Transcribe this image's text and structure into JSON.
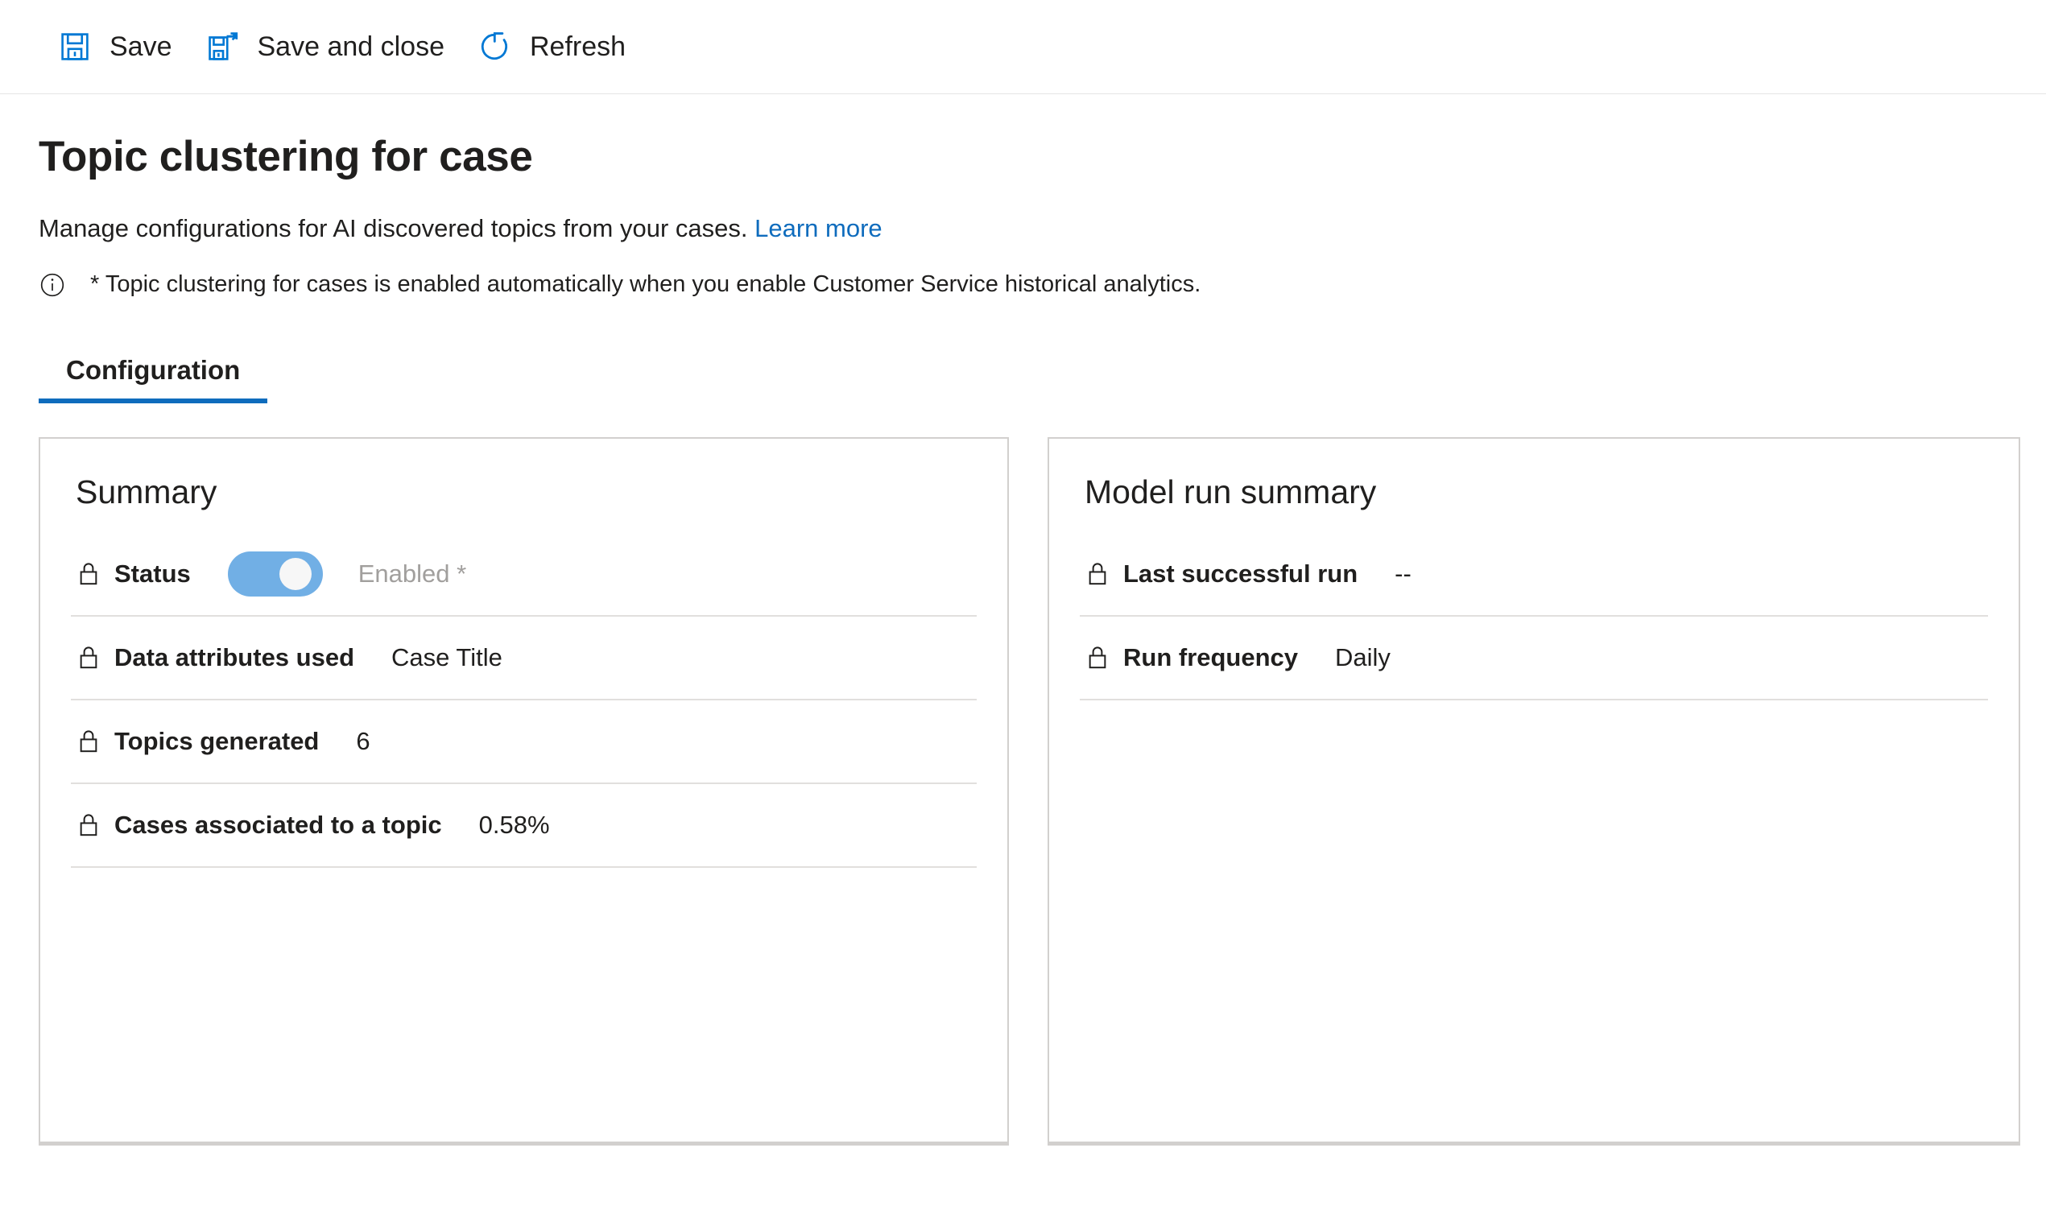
{
  "colors": {
    "accent": "#0f6cbd",
    "icon_blue": "#0078d4",
    "toggle_on": "#71afe5",
    "border": "#d2d0ce",
    "divider": "#e1dfdd",
    "muted_text": "#a19f9d"
  },
  "commandbar": {
    "buttons": [
      {
        "label": "Save",
        "icon": "save-icon"
      },
      {
        "label": "Save and close",
        "icon": "save-and-close-icon"
      },
      {
        "label": "Refresh",
        "icon": "refresh-icon"
      }
    ]
  },
  "header": {
    "title": "Topic clustering for case",
    "description": "Manage configurations for AI discovered topics from your cases.",
    "learn_more": "Learn more",
    "note_icon": "info-icon",
    "note": "* Topic clustering for cases is enabled automatically when you enable Customer Service historical analytics."
  },
  "tabs": [
    {
      "label": "Configuration",
      "active": true
    }
  ],
  "summary_card": {
    "title": "Summary",
    "rows": [
      {
        "label": "Status",
        "icon": "lock-icon",
        "type": "toggle",
        "toggle_on": true,
        "value": "Enabled *"
      },
      {
        "label": "Data attributes used",
        "icon": "lock-icon",
        "type": "text",
        "value": "Case Title"
      },
      {
        "label": "Topics generated",
        "icon": "lock-icon",
        "type": "text",
        "value": "6"
      },
      {
        "label": "Cases associated to a topic",
        "icon": "lock-icon",
        "type": "text",
        "value": "0.58%"
      }
    ]
  },
  "model_run_card": {
    "title": "Model run summary",
    "rows": [
      {
        "label": "Last successful run",
        "icon": "lock-icon",
        "type": "text",
        "value": "--"
      },
      {
        "label": "Run frequency",
        "icon": "lock-icon",
        "type": "text",
        "value": "Daily"
      }
    ]
  }
}
